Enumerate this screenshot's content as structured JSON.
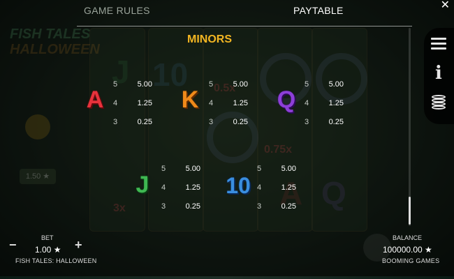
{
  "tabs": {
    "game_rules": "GAME RULES",
    "paytable": "PAYTABLE",
    "active": "paytable"
  },
  "close_label": "✕",
  "section_title": "MINORS",
  "symbols": [
    {
      "symbol": "A",
      "color": "#e8323c",
      "payouts": [
        {
          "count": "5",
          "value": "5.00"
        },
        {
          "count": "4",
          "value": "1.25"
        },
        {
          "count": "3",
          "value": "0.25"
        }
      ]
    },
    {
      "symbol": "K",
      "color": "#f08a1a",
      "payouts": [
        {
          "count": "5",
          "value": "5.00"
        },
        {
          "count": "4",
          "value": "1.25"
        },
        {
          "count": "3",
          "value": "0.25"
        }
      ]
    },
    {
      "symbol": "Q",
      "color": "#8d3fd8",
      "payouts": [
        {
          "count": "5",
          "value": "5.00"
        },
        {
          "count": "4",
          "value": "1.25"
        },
        {
          "count": "3",
          "value": "0.25"
        }
      ]
    },
    {
      "symbol": "J",
      "color": "#3fb852",
      "payouts": [
        {
          "count": "5",
          "value": "5.00"
        },
        {
          "count": "4",
          "value": "1.25"
        },
        {
          "count": "3",
          "value": "0.25"
        }
      ]
    },
    {
      "symbol": "10",
      "color": "#3a8ee0",
      "payouts": [
        {
          "count": "5",
          "value": "5.00"
        },
        {
          "count": "4",
          "value": "1.25"
        },
        {
          "count": "3",
          "value": "0.25"
        }
      ]
    }
  ],
  "side_menu": [
    "menu-icon",
    "info-icon",
    "coins-icon"
  ],
  "footer": {
    "bet_label": "BET",
    "bet_value": "1.00 ★",
    "minus": "−",
    "plus": "+",
    "game_name": "FISH TALES: HALLOWEEN",
    "balance_label": "BALANCE",
    "balance_value": "100000.00 ★",
    "studio": "BOOMING GAMES"
  },
  "background": {
    "logo_line1": "FISH TALES",
    "logo_line2": "HALLOWEEN",
    "multiplier_a": "0.5x",
    "multiplier_b": "0.75x",
    "multiplier_c": "3x",
    "mini_value": "1.50 ★"
  },
  "colors": {
    "accent": "#f2b522",
    "text": "#ffffff"
  }
}
